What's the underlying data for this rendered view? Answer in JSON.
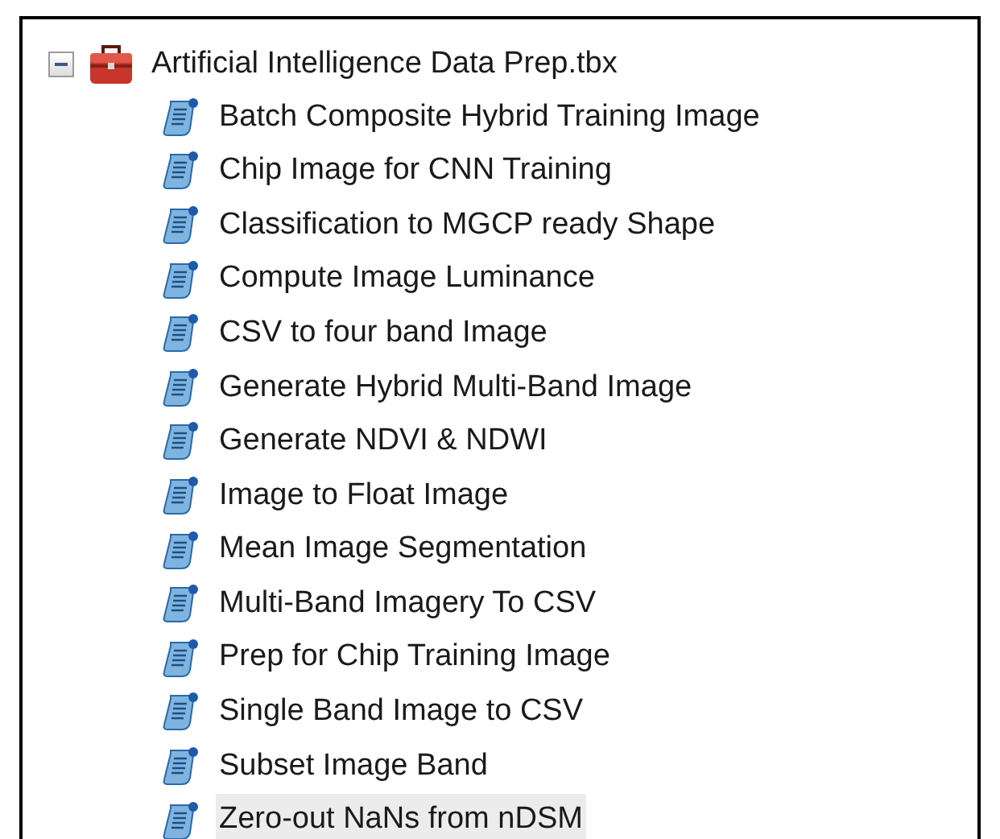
{
  "toolbox": {
    "label": "Artificial Intelligence Data Prep.tbx",
    "expanded": true,
    "children": [
      {
        "label": "Batch Composite Hybrid Training Image",
        "selected": false
      },
      {
        "label": "Chip Image for CNN Training",
        "selected": false
      },
      {
        "label": "Classification to MGCP ready Shape",
        "selected": false
      },
      {
        "label": "Compute Image Luminance",
        "selected": false
      },
      {
        "label": "CSV to four band Image",
        "selected": false
      },
      {
        "label": "Generate Hybrid Multi-Band Image",
        "selected": false
      },
      {
        "label": "Generate NDVI & NDWI",
        "selected": false
      },
      {
        "label": "Image to Float Image",
        "selected": false
      },
      {
        "label": "Mean Image Segmentation",
        "selected": false
      },
      {
        "label": "Multi-Band Imagery To CSV",
        "selected": false
      },
      {
        "label": "Prep for Chip Training Image",
        "selected": false
      },
      {
        "label": "Single Band Image to CSV",
        "selected": false
      },
      {
        "label": "Subset Image Band",
        "selected": false
      },
      {
        "label": "Zero-out NaNs from nDSM",
        "selected": true
      }
    ]
  }
}
